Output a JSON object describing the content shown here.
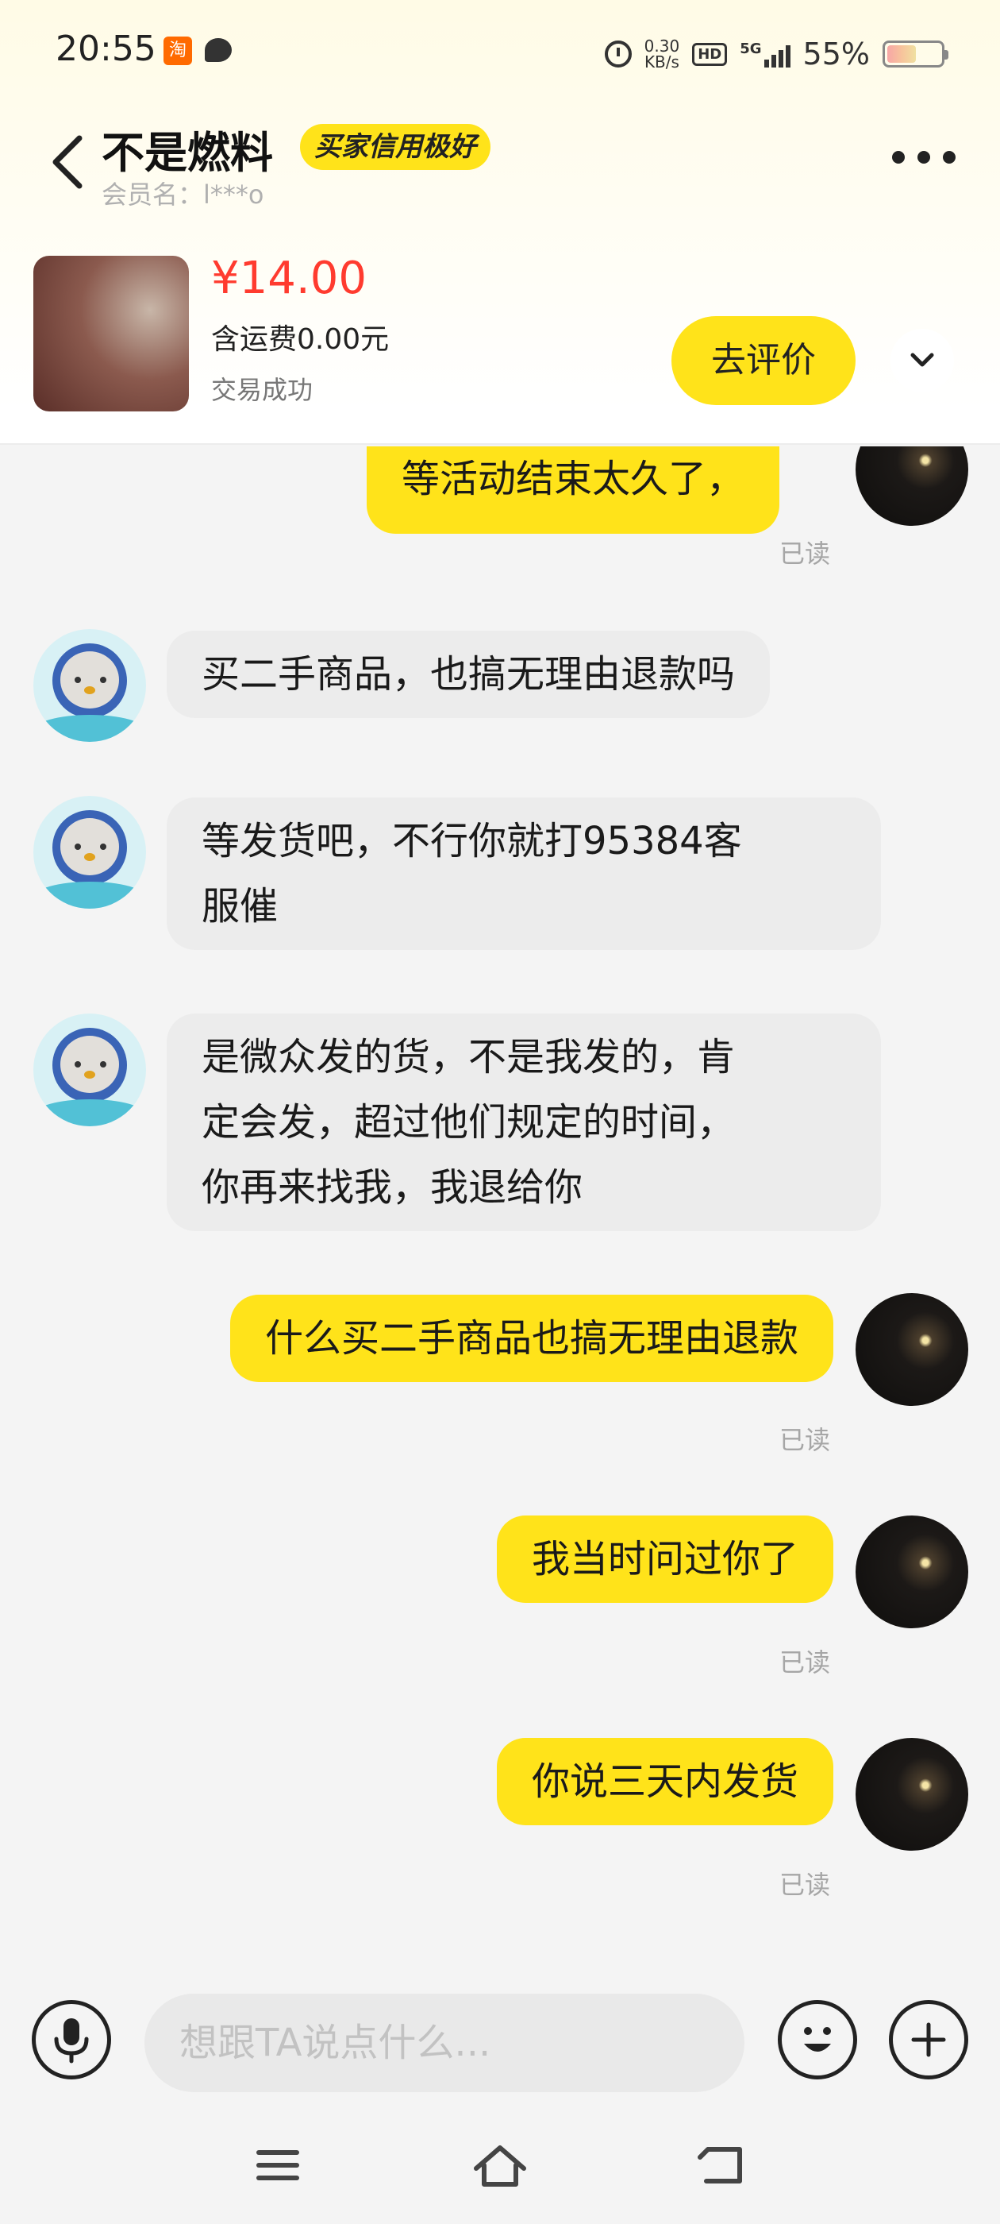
{
  "status_bar": {
    "time": "20:55",
    "taobao_icon_text": "淘",
    "net_speed_value": "0.30",
    "net_speed_unit": "KB/s",
    "hd_label": "HD",
    "signal_label": "5G",
    "battery_percent": "55%",
    "battery_level": 0.55
  },
  "header": {
    "title": "不是燃料",
    "credit_badge": "买家信用极好",
    "member_name": "会员名：l***o"
  },
  "product": {
    "price": "¥14.00",
    "shipping": "含运费0.00元",
    "status": "交易成功",
    "review_button": "去评价"
  },
  "messages": [
    {
      "side": "out",
      "text": "等活动结束太久了，",
      "read": "已读"
    },
    {
      "side": "in",
      "text": "买二手商品，也搞无理由退款吗"
    },
    {
      "side": "in",
      "lines": [
        "等发货吧，不行你就打95384客",
        "服催"
      ]
    },
    {
      "side": "in",
      "lines": [
        "是微众发的货，不是我发的，肯",
        "定会发，超过他们规定的时间，",
        "你再来找我，我退给你"
      ]
    },
    {
      "side": "out",
      "text": "什么买二手商品也搞无理由退款",
      "read": "已读"
    },
    {
      "side": "out",
      "text": "我当时问过你了",
      "read": "已读"
    },
    {
      "side": "out",
      "text": "你说三天内发货",
      "read": "已读"
    }
  ],
  "input": {
    "placeholder": "想跟TA说点什么..."
  },
  "colors": {
    "accent_yellow": "#ffe31a",
    "price_red": "#ff3b2f",
    "incoming_bubble": "#ececec",
    "read_gray": "#a6a6a6"
  },
  "icons": [
    "back-arrow-icon",
    "more-icon",
    "chevron-down-icon",
    "microphone-icon",
    "emoji-icon",
    "plus-icon",
    "menu-icon",
    "home-icon",
    "back-icon"
  ]
}
